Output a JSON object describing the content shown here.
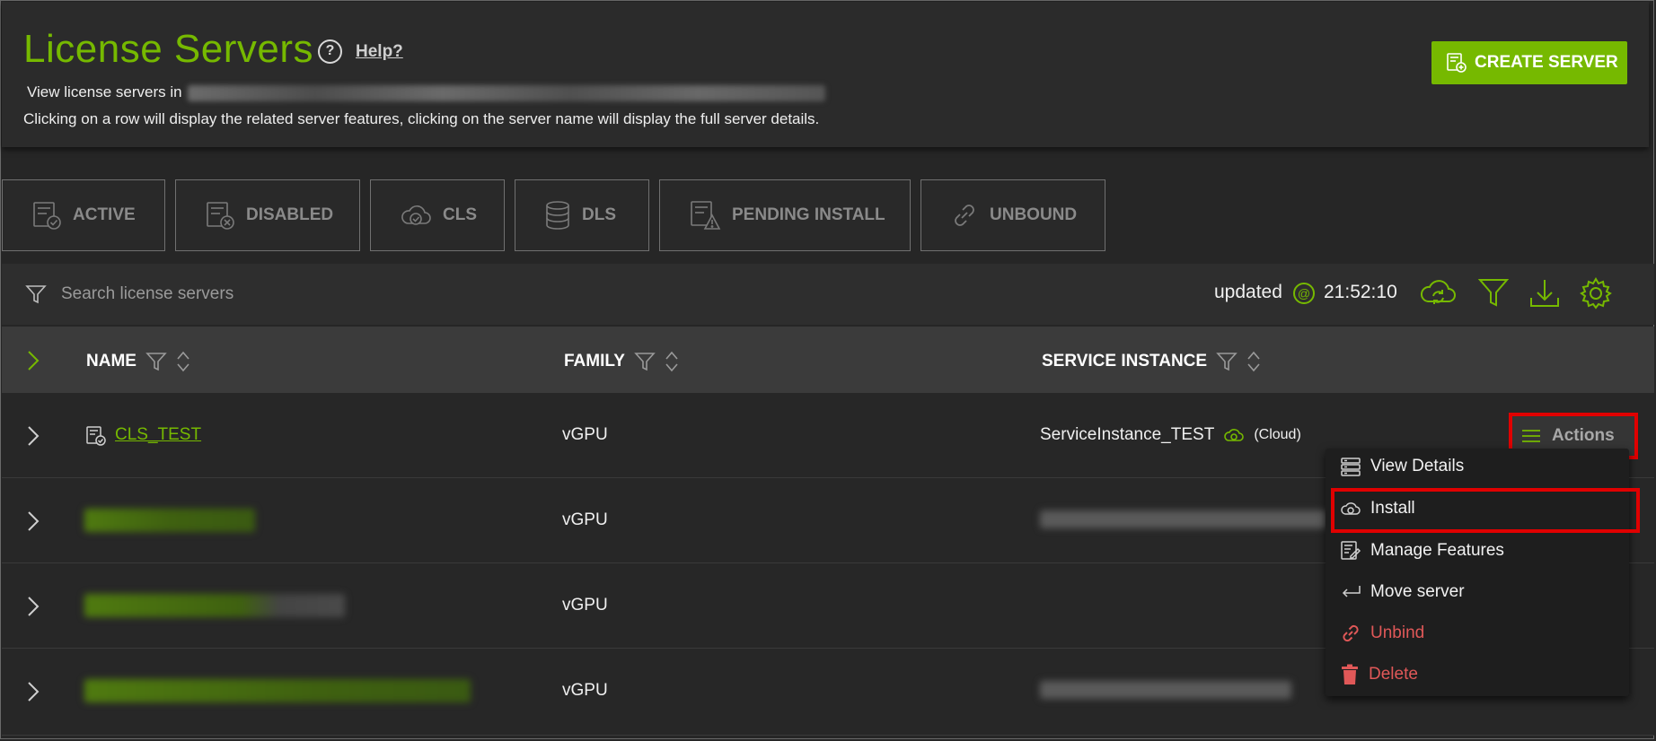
{
  "header": {
    "title": "License Servers",
    "help_label": "Help?",
    "subtitle_prefix": "View license servers in",
    "instructions": "Clicking on a row will display the related server features, clicking on the server name will display the full server details.",
    "create_button": "CREATE SERVER"
  },
  "tabs": [
    {
      "label": "ACTIVE",
      "icon": "server-check-icon"
    },
    {
      "label": "DISABLED",
      "icon": "server-x-icon"
    },
    {
      "label": "CLS",
      "icon": "cloud-check-icon"
    },
    {
      "label": "DLS",
      "icon": "database-icon"
    },
    {
      "label": "PENDING INSTALL",
      "icon": "server-warning-icon"
    },
    {
      "label": "UNBOUND",
      "icon": "link-icon"
    }
  ],
  "toolbar": {
    "search_placeholder": "Search license servers",
    "updated_label": "updated",
    "updated_time": "21:52:10",
    "icons": [
      "cloud-sync-icon",
      "filter-icon",
      "download-icon",
      "gear-icon"
    ]
  },
  "table": {
    "columns": [
      "NAME",
      "FAMILY",
      "SERVICE INSTANCE"
    ],
    "rows": [
      {
        "name": "CLS_TEST",
        "family": "vGPU",
        "service_instance": "ServiceInstance_TEST",
        "service_type": "(Cloud)"
      },
      {
        "name": "",
        "family": "vGPU",
        "service_instance": ""
      },
      {
        "name": "",
        "family": "vGPU",
        "service_instance": ""
      },
      {
        "name": "",
        "family": "vGPU",
        "service_instance": ""
      }
    ]
  },
  "actions": {
    "button_label": "Actions",
    "menu": [
      {
        "label": "View Details",
        "icon": "server-details-icon"
      },
      {
        "label": "Install",
        "icon": "cloud-install-icon"
      },
      {
        "label": "Manage Features",
        "icon": "edit-features-icon"
      },
      {
        "label": "Move server",
        "icon": "move-arrow-icon"
      },
      {
        "label": "Unbind",
        "icon": "link-icon"
      },
      {
        "label": "Delete",
        "icon": "trash-icon"
      }
    ]
  },
  "colors": {
    "accent": "#76b900",
    "danger": "#e05858",
    "highlight": "#e00000",
    "background": "#262626"
  }
}
